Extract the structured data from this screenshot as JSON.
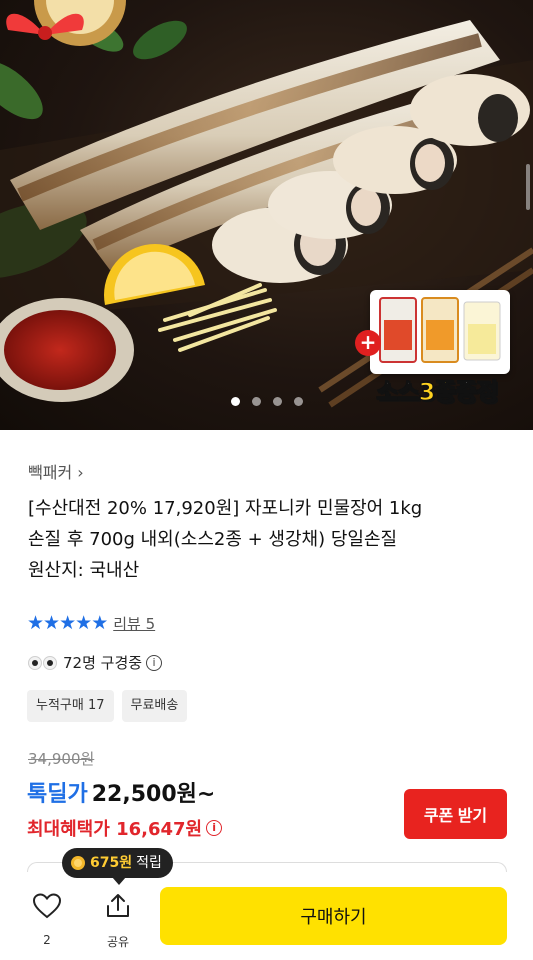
{
  "gallery": {
    "gift_caption_part1": "소스",
    "gift_caption_highlight": "3종",
    "gift_caption_part2": "증정",
    "slides_total": 4,
    "active_slide": 1
  },
  "product": {
    "brand": "빽패커",
    "brand_chevron": "›",
    "title_lines": [
      "[수산대전 20% 17,920원] 자포니카 민물장어 1kg",
      "손질 후 700g 내외(소스2종 + 생강채) 당일손질",
      "원산지: 국내산"
    ],
    "rating_stars": 5,
    "review_label": "리뷰 5",
    "viewers_text": "72명 구경중",
    "tags": [
      "누적구매 17",
      "무료배송"
    ]
  },
  "price": {
    "original": "34,900원",
    "deal_label": "톡딜가",
    "deal_price": "22,500원~",
    "benefit_label": "최대혜택가 16,647원",
    "coupon_button": "쿠폰 받기"
  },
  "bottom_bar": {
    "points_value": "675원",
    "points_suffix": "적립",
    "like_count": "2",
    "share_label": "공유",
    "buy_button": "구매하기"
  },
  "colors": {
    "accent_blue": "#1f6fe5",
    "sale_red": "#e1262c",
    "coupon_red": "#e8231f",
    "buy_yellow": "#ffe100"
  },
  "icons": [
    "heart-icon",
    "share-icon",
    "info-icon",
    "eyes-icon",
    "star-icon",
    "coin-icon",
    "plus-icon",
    "chevron-right-icon"
  ]
}
